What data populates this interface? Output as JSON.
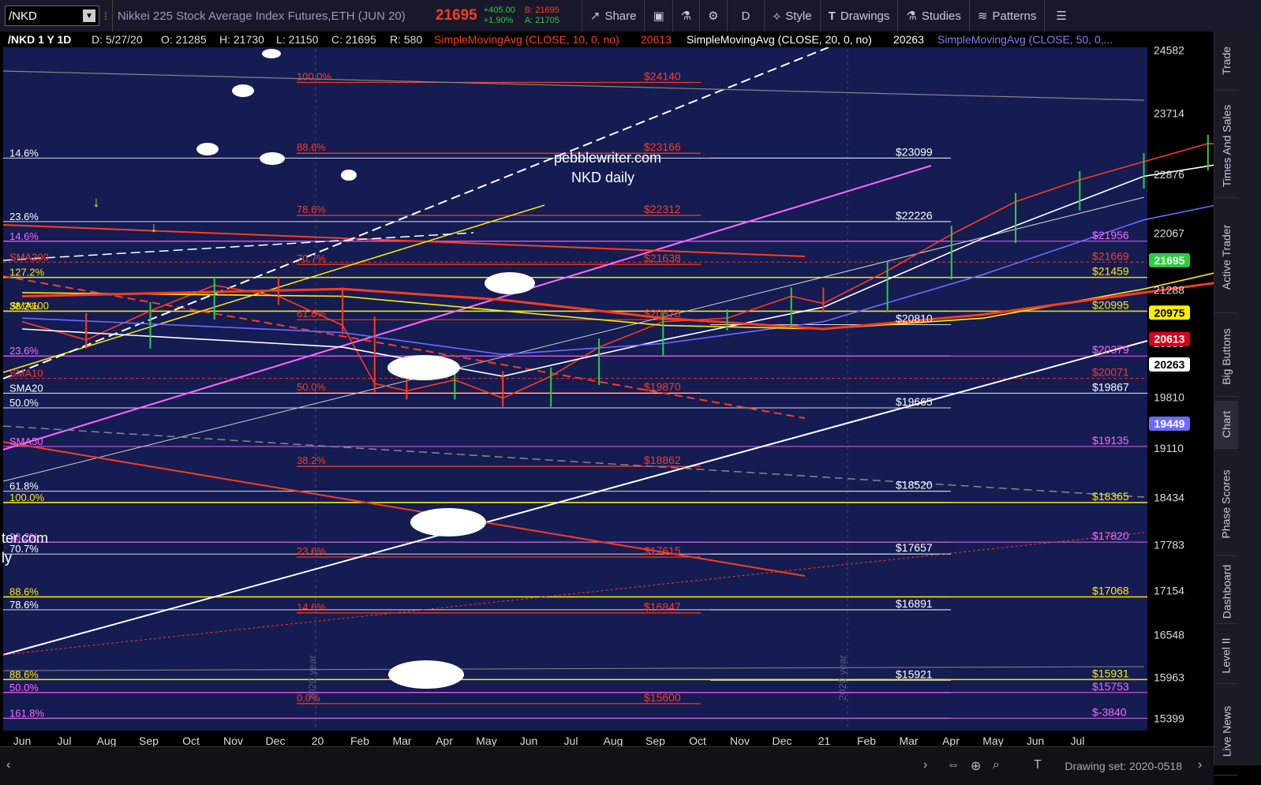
{
  "toolbar": {
    "symbol": "/NKD",
    "description": "Nikkei 225 Stock Average Index Futures,ETH (JUN 20)",
    "last": "21695",
    "change": "+405.00",
    "change_pct": "+1.90%",
    "bid": "B: 21695",
    "ask": "A: 21705",
    "share": "Share",
    "period": "D",
    "style": "Style",
    "drawings": "Drawings",
    "studies": "Studies",
    "patterns": "Patterns",
    "icons": [
      "share-icon",
      "screenshot-icon",
      "flask-icon",
      "gear-icon",
      "style-icon",
      "text-icon",
      "studies-icon",
      "patterns-icon",
      "menu-icon"
    ]
  },
  "info_bar": {
    "label": "/NKD 1 Y 1D",
    "date": "D: 5/27/20",
    "open": "O: 21285",
    "high": "H: 21730",
    "low": "L: 21150",
    "close": "C: 21695",
    "range": "R: 580",
    "sma10": "SimpleMovingAvg (CLOSE, 10, 0, no)",
    "sma10_val": "20613",
    "sma20": "SimpleMovingAvg (CLOSE, 20, 0, no)",
    "sma20_val": "20263",
    "sma50": "SimpleMovingAvg (CLOSE, 50, 0,..."
  },
  "right_tabs": [
    "Trade",
    "Times And Sales",
    "Active Trader",
    "Big Buttons",
    "Chart",
    "Phase Scores",
    "Dashboard",
    "Level II",
    "Live News"
  ],
  "bottom": {
    "drawing_set": "Drawing set: 2020-0518"
  },
  "chart_data": {
    "type": "line",
    "watermark": [
      "pebblewriter.com",
      "NKD daily"
    ],
    "watermark_partial": [
      "ter.com",
      "ly"
    ],
    "x_ticks": [
      "Jun",
      "Jul",
      "Aug",
      "Sep",
      "Oct",
      "Nov",
      "Dec",
      "20",
      "Feb",
      "Mar",
      "Apr",
      "May",
      "Jun",
      "Jul",
      "Aug",
      "Sep",
      "Oct",
      "Nov",
      "Dec",
      "21",
      "Feb",
      "Mar",
      "Apr",
      "May",
      "Jun",
      "Jul"
    ],
    "y_ticks": [
      "24582",
      "23714",
      "22876",
      "22067",
      "21288",
      "20555",
      "19810",
      "19110",
      "18434",
      "17783",
      "17154",
      "16548",
      "15963",
      "15399"
    ],
    "ylim": [
      15230,
      24600
    ],
    "year_labels": [
      "2020 year",
      "2020 year"
    ],
    "price_bubbles": [
      {
        "text": "21695",
        "color": "#2ecc40",
        "value": 21695
      },
      {
        "text": "20975",
        "color": "#ffee00",
        "value": 20975
      },
      {
        "text": "20613",
        "color": "#d9001b",
        "value": 20613
      },
      {
        "text": "20263",
        "color": "#ffffff",
        "value": 20263
      },
      {
        "text": "19449",
        "color": "#6a6aff",
        "value": 19449
      }
    ],
    "fib_left": [
      {
        "text": "14.6%",
        "color": "#ffffff",
        "value": 23099
      },
      {
        "text": "23.6%",
        "color": "#ffffff",
        "value": 22226
      },
      {
        "text": "14.6%",
        "color": "#ff66ff",
        "value": 21956
      },
      {
        "text": "127.2%",
        "color": "#ffee00",
        "value": 21459
      },
      {
        "text": "38.2%",
        "color": "#ffee00",
        "value": 20995
      },
      {
        "text": "23.6%",
        "color": "#ff66ff",
        "value": 20379
      },
      {
        "text": "50.0%",
        "color": "#ffffff",
        "value": 19665
      },
      {
        "text": "61.8%",
        "color": "#ffffff",
        "value": 18520
      },
      {
        "text": "100.0%",
        "color": "#ffee00",
        "value": 18365
      },
      {
        "text": "38.2%",
        "color": "#ff66ff",
        "value": 17820
      },
      {
        "text": "70.7%",
        "color": "#ffffff",
        "value": 17657
      },
      {
        "text": "88.6%",
        "color": "#ffee00",
        "value": 17068
      },
      {
        "text": "78.6%",
        "color": "#ffffff",
        "value": 16891
      },
      {
        "text": "88.6%",
        "color": "#ffee00",
        "value": 15931
      },
      {
        "text": "50.0%",
        "color": "#ff66ff",
        "value": 15753
      },
      {
        "text": "161.8%",
        "color": "#ff66ff",
        "value": 15399
      }
    ],
    "sma_labels": [
      {
        "text": "SMA200",
        "color": "#ff3b1d",
        "value": 21669
      },
      {
        "text": "SMA100",
        "color": "#ffee00",
        "value": 21000
      },
      {
        "text": "SMA10",
        "color": "#ff3b1d",
        "value": 20071
      },
      {
        "text": "SMA20",
        "color": "#ffffff",
        "value": 19867
      },
      {
        "text": "SMA50",
        "color": "#ff66ff",
        "value": 19135
      }
    ],
    "fib_mid": [
      {
        "pct": "100.0%",
        "price": "$24140",
        "value": 24140
      },
      {
        "pct": "88.6%",
        "price": "$23166",
        "value": 23166
      },
      {
        "pct": "78.6%",
        "price": "$22312",
        "value": 22312
      },
      {
        "pct": "70.7%",
        "price": "$21638",
        "value": 21638
      },
      {
        "pct": "61.8%",
        "price": "$20878",
        "value": 20878
      },
      {
        "pct": "50.0%",
        "price": "$19870",
        "value": 19870
      },
      {
        "pct": "38.2%",
        "price": "$18862",
        "value": 18862
      },
      {
        "pct": "23.6%",
        "price": "$17615",
        "value": 17615
      },
      {
        "pct": "14.6%",
        "price": "$16847",
        "value": 16847
      },
      {
        "pct": "0.0%",
        "price": "$15600",
        "value": 15600
      }
    ],
    "white_levels": [
      "$23099",
      "$22226",
      "$20810",
      "$19665",
      "$18520",
      "$17657",
      "$16891",
      "$15921"
    ],
    "right_levels": [
      {
        "text": "$21956",
        "color": "#ff66ff",
        "value": 21956
      },
      {
        "text": "$21669",
        "color": "#ff3b1d",
        "value": 21669
      },
      {
        "text": "$21459",
        "color": "#ffee00",
        "value": 21459
      },
      {
        "text": "$20995",
        "color": "#ffee00",
        "value": 20995
      },
      {
        "text": "$20379",
        "color": "#ff66ff",
        "value": 20379
      },
      {
        "text": "$20071",
        "color": "#ff3b1d",
        "value": 20071
      },
      {
        "text": "$19867",
        "color": "#ffffff",
        "value": 19867
      },
      {
        "text": "$19135",
        "color": "#ff66ff",
        "value": 19135
      },
      {
        "text": "$18365",
        "color": "#ffee00",
        "value": 18365
      },
      {
        "text": "$17820",
        "color": "#ff66ff",
        "value": 17820
      },
      {
        "text": "$17068",
        "color": "#ffee00",
        "value": 17068
      },
      {
        "text": "$15931",
        "color": "#ffee00",
        "value": 15931
      },
      {
        "text": "$15753",
        "color": "#ff66ff",
        "value": 15753
      },
      {
        "text": "$-3840",
        "color": "#ff66ff",
        "value": 15399
      }
    ],
    "series": [
      {
        "name": "NKD close",
        "color": "#ff3b1d",
        "points": [
          [
            0,
            20850
          ],
          [
            4,
            20600
          ],
          [
            8,
            21000
          ],
          [
            12,
            21350
          ],
          [
            16,
            21200
          ],
          [
            20,
            20800
          ],
          [
            22,
            20000
          ],
          [
            24,
            19900
          ],
          [
            27,
            20050
          ],
          [
            30,
            19800
          ],
          [
            33,
            20100
          ],
          [
            36,
            20500
          ],
          [
            40,
            20850
          ],
          [
            44,
            20900
          ],
          [
            48,
            21200
          ],
          [
            50,
            21100
          ],
          [
            54,
            21550
          ],
          [
            58,
            22050
          ],
          [
            62,
            22500
          ],
          [
            66,
            22800
          ],
          [
            70,
            23050
          ],
          [
            74,
            23300
          ],
          [
            78,
            23250
          ],
          [
            82,
            23400
          ],
          [
            86,
            23700
          ],
          [
            90,
            23650
          ],
          [
            94,
            23800
          ],
          [
            96,
            23600
          ],
          [
            100,
            23550
          ],
          [
            104,
            23650
          ],
          [
            108,
            23900
          ],
          [
            110,
            23350
          ],
          [
            114,
            23050
          ],
          [
            118,
            23000
          ],
          [
            120,
            23450
          ],
          [
            124,
            23700
          ],
          [
            126,
            23500
          ],
          [
            128,
            23200
          ],
          [
            130,
            22300
          ],
          [
            132,
            21500
          ],
          [
            134,
            20900
          ],
          [
            136,
            20500
          ],
          [
            138,
            19950
          ],
          [
            140,
            18900
          ],
          [
            142,
            17400
          ],
          [
            143,
            16400
          ],
          [
            144,
            17300
          ],
          [
            146,
            18100
          ],
          [
            148,
            18800
          ],
          [
            150,
            19100
          ],
          [
            154,
            19400
          ],
          [
            156,
            19000
          ],
          [
            158,
            19400
          ],
          [
            160,
            19850
          ],
          [
            164,
            19650
          ],
          [
            166,
            19950
          ],
          [
            168,
            20200
          ],
          [
            170,
            20150
          ],
          [
            172,
            20550
          ],
          [
            174,
            20700
          ],
          [
            176,
            21100
          ],
          [
            177,
            21695
          ]
        ]
      },
      {
        "name": "SMA20",
        "color": "#ffffff",
        "points": [
          [
            0,
            20750
          ],
          [
            20,
            20500
          ],
          [
            30,
            20100
          ],
          [
            40,
            20600
          ],
          [
            50,
            21050
          ],
          [
            60,
            22000
          ],
          [
            70,
            22850
          ],
          [
            80,
            23200
          ],
          [
            90,
            23600
          ],
          [
            100,
            23500
          ],
          [
            110,
            23400
          ],
          [
            120,
            23300
          ],
          [
            128,
            23350
          ],
          [
            134,
            22200
          ],
          [
            138,
            20300
          ],
          [
            142,
            18800
          ],
          [
            148,
            18100
          ],
          [
            154,
            18500
          ],
          [
            160,
            19300
          ],
          [
            166,
            19850
          ],
          [
            172,
            20050
          ],
          [
            177,
            20263
          ]
        ]
      },
      {
        "name": "SMA50",
        "color": "#6a6aff",
        "points": [
          [
            0,
            20900
          ],
          [
            20,
            20700
          ],
          [
            30,
            20400
          ],
          [
            40,
            20550
          ],
          [
            50,
            20850
          ],
          [
            60,
            21500
          ],
          [
            70,
            22250
          ],
          [
            80,
            22700
          ],
          [
            90,
            23100
          ],
          [
            100,
            23300
          ],
          [
            110,
            23400
          ],
          [
            120,
            23450
          ],
          [
            128,
            23500
          ],
          [
            134,
            23100
          ],
          [
            140,
            21700
          ],
          [
            146,
            20400
          ],
          [
            152,
            19600
          ],
          [
            158,
            19200
          ],
          [
            164,
            19000
          ],
          [
            170,
            19100
          ],
          [
            176,
            19449
          ]
        ]
      },
      {
        "name": "SMA100",
        "color": "#ffee00",
        "points": [
          [
            0,
            21250
          ],
          [
            20,
            21200
          ],
          [
            30,
            21000
          ],
          [
            40,
            20800
          ],
          [
            50,
            20750
          ],
          [
            60,
            20900
          ],
          [
            70,
            21300
          ],
          [
            80,
            21800
          ],
          [
            90,
            22200
          ],
          [
            100,
            22500
          ],
          [
            110,
            22700
          ],
          [
            120,
            22900
          ],
          [
            128,
            23000
          ],
          [
            134,
            22700
          ],
          [
            140,
            22300
          ],
          [
            146,
            21850
          ],
          [
            152,
            21500
          ],
          [
            158,
            21300
          ],
          [
            164,
            21150
          ],
          [
            170,
            21050
          ],
          [
            176,
            20975
          ]
        ]
      },
      {
        "name": "SMA200",
        "color": "#ff3b1d",
        "points": [
          [
            0,
            21200
          ],
          [
            20,
            21300
          ],
          [
            30,
            21150
          ],
          [
            40,
            20900
          ],
          [
            50,
            20750
          ],
          [
            60,
            20950
          ],
          [
            70,
            21250
          ],
          [
            80,
            21550
          ],
          [
            90,
            21750
          ],
          [
            100,
            21900
          ],
          [
            110,
            22050
          ],
          [
            120,
            22150
          ],
          [
            128,
            22250
          ],
          [
            134,
            22200
          ],
          [
            140,
            22150
          ],
          [
            146,
            22050
          ],
          [
            152,
            21950
          ],
          [
            158,
            21850
          ],
          [
            164,
            21750
          ],
          [
            170,
            21700
          ],
          [
            176,
            21669
          ]
        ]
      }
    ]
  }
}
